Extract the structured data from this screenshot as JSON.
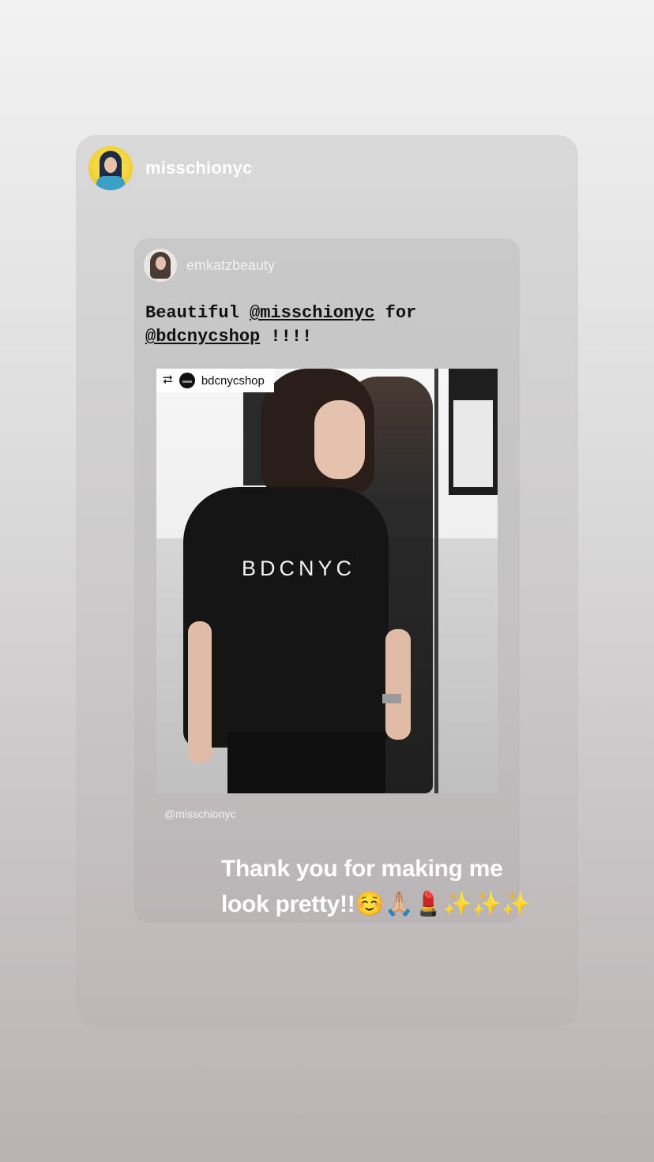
{
  "story": {
    "author": "misschionyc",
    "shared_post": {
      "author": "emkatzbeauty",
      "caption": {
        "line1_prefix": "Beautiful ",
        "mention1": "@misschionyc",
        "line1_suffix": " for",
        "mention2": "@bdcnycshop",
        "line2_suffix": " !!!!"
      },
      "repost_badge": {
        "icon": "repost-icon",
        "icon_glyph": "⮂",
        "account": "bdcnycshop"
      },
      "shirt_text": "BDCNYC",
      "photo_credit": "@misschionyc"
    },
    "overlay_text": {
      "line1": "Thank you for making me",
      "line2": "look pretty!!☺️🙏🏼💄✨✨✨"
    }
  }
}
